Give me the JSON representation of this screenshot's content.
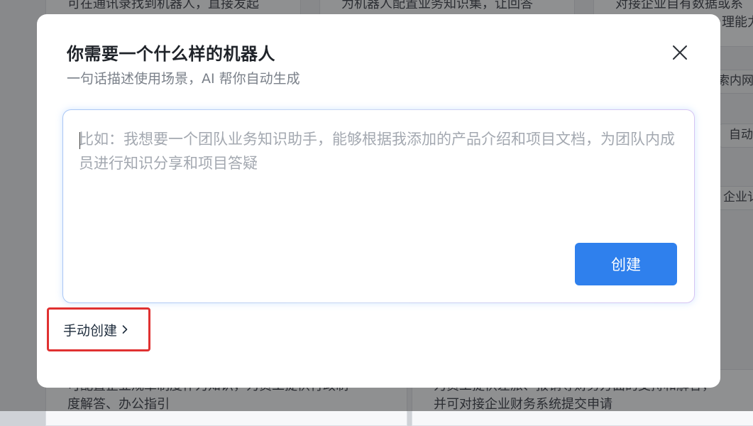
{
  "background": {
    "cards": [
      {
        "lines": [
          "可在通讯录找到机器人，直接发起"
        ]
      },
      {
        "lines": [
          "为机器人配置业务知识集，让回答"
        ]
      },
      {
        "lines": [
          "对接企业自有数据或系",
          "理能力"
        ]
      },
      {
        "lines": [
          "可配置企业规章制度作为知识，为员工提供行政制",
          "度解答、办公指引"
        ]
      },
      {
        "lines": [
          "为员工提供差旅、报销等财务方面的支持和解答，",
          "并可对接企业财务系统提交申请"
        ]
      }
    ],
    "pills": [
      "索内网",
      "自动",
      "企业讠"
    ]
  },
  "modal": {
    "title": "你需要一个什么样的机器人",
    "subtitle": "一句话描述使用场景，AI 帮你自动生成",
    "prompt": {
      "value": "",
      "placeholder": "比如：我想要一个团队业务知识助手，能够根据我添加的产品介绍和项目文档，为团队内成员进行知识分享和项目答疑"
    },
    "create_label": "创建",
    "manual_label": "手动创建"
  },
  "icons": {
    "close": "close-icon",
    "chevron": "chevron-right-icon"
  },
  "colors": {
    "primary": "#2f80ed",
    "highlight": "#e03131"
  }
}
